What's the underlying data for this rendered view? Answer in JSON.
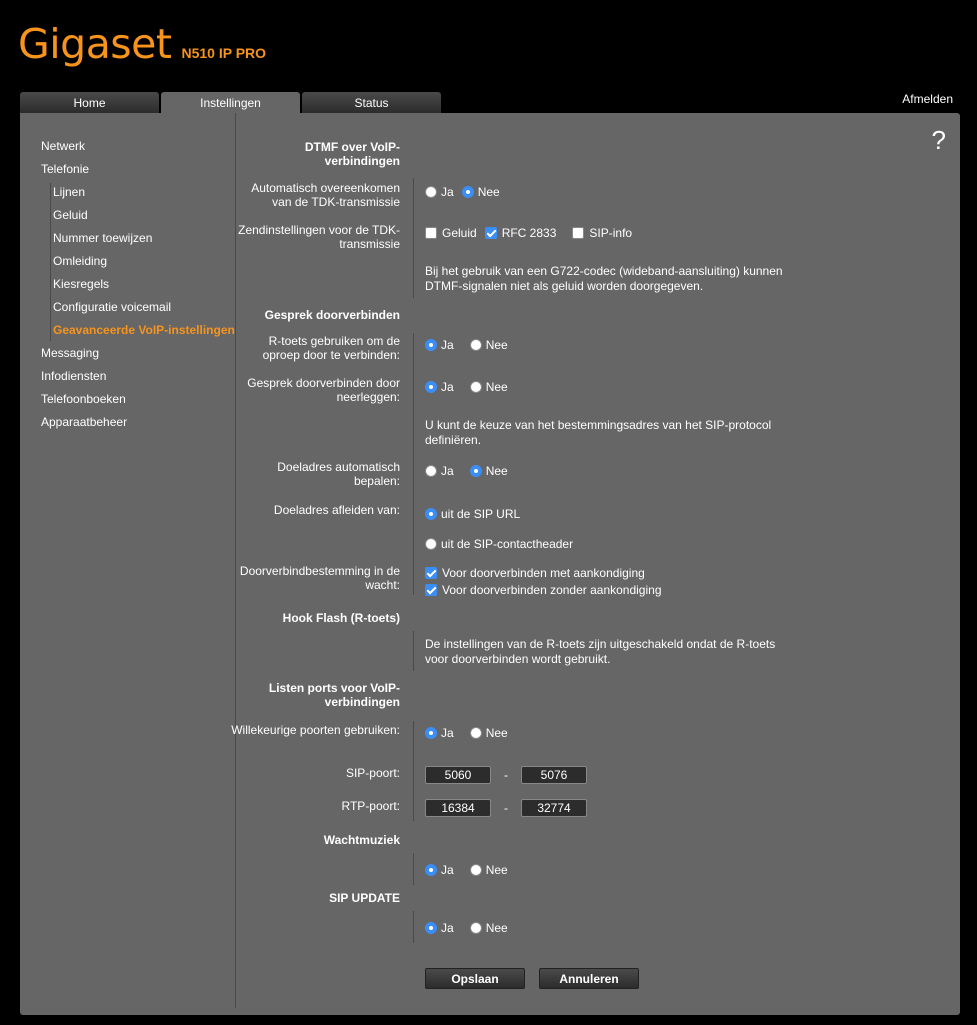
{
  "header": {
    "brand": "Gigaset",
    "model": "N510 IP PRO",
    "logout": "Afmelden",
    "help": "?"
  },
  "tabs": [
    "Home",
    "Instellingen",
    "Status"
  ],
  "sidebar": {
    "items": [
      "Netwerk",
      "Telefonie",
      "Lijnen",
      "Geluid",
      "Nummer toewijzen",
      "Omleiding",
      "Kiesregels",
      "Configuratie voicemail",
      "Geavanceerde VoIP-instellingen",
      "Messaging",
      "Infodiensten",
      "Telefoonboeken",
      "Apparaatbeheer"
    ]
  },
  "dtmf": {
    "heading": "DTMF over VoIP-verbindingen",
    "auto_label": "Automatisch overeenkomen van de TDK-transmissie",
    "ja": "Ja",
    "nee": "Nee",
    "send_label": "Zendinstellingen voor de TDK-transmissie",
    "opt_geluid": "Geluid",
    "opt_rfc": "RFC 2833",
    "opt_sip": "SIP-info",
    "info": "Bij het gebruik van een G722-codec (wideband-aansluiting) kunnen DTMF-signalen niet als geluid worden doorgegeven."
  },
  "transfer": {
    "heading": "Gesprek doorverbinden",
    "rkey_label": "R-toets gebruiken om de oproep door te verbinden:",
    "hangup_label": "Gesprek doorverbinden door neerleggen:",
    "info": "U kunt de keuze van het bestemmingsadres van het SIP-protocol definiëren.",
    "auto_target_label": "Doeladres automatisch bepalen:",
    "derive_label": "Doeladres afleiden van:",
    "opt_url": "uit de SIP URL",
    "opt_contact": "uit de SIP-contactheader",
    "hold_label": "Doorverbindbestemming in de wacht:",
    "opt_with": "Voor doorverbinden met aankondiging",
    "opt_without": "Voor doorverbinden zonder aankondiging"
  },
  "hook": {
    "heading": "Hook Flash (R-toets)",
    "info": "De instellingen van de R-toets zijn uitgeschakeld ondat de R-toets voor doorverbinden wordt gebruikt."
  },
  "ports": {
    "heading": "Listen ports voor VoIP-verbindingen",
    "random_label": "Willekeurige poorten gebruiken:",
    "sip_label": "SIP-poort:",
    "sip_from": "5060",
    "sip_to": "5076",
    "rtp_label": "RTP-poort:",
    "rtp_from": "16384",
    "rtp_to": "32774",
    "dash": "-"
  },
  "music": {
    "heading": "Wachtmuziek"
  },
  "sipupdate": {
    "heading": "SIP UPDATE"
  },
  "buttons": {
    "save": "Opslaan",
    "cancel": "Annuleren"
  }
}
